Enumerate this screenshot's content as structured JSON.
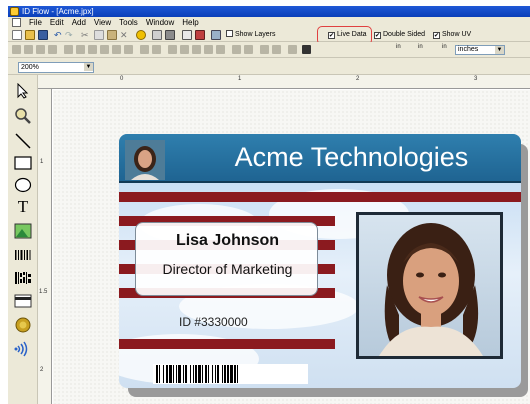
{
  "window": {
    "title": "ID Flow - [Acme.jpx]"
  },
  "menu": [
    "File",
    "Edit",
    "Add",
    "View",
    "Tools",
    "Window",
    "Help"
  ],
  "toolbar": {
    "show_layers": "Show Layers",
    "live_data": "Live Data",
    "double_sided": "Double Sided",
    "show_uv": "Show UV",
    "show_layers_checked": false,
    "live_data_checked": true,
    "double_sided_checked": true,
    "show_uv_checked": true,
    "dimension_label_w": "in",
    "dimension_label_h": "in",
    "units": "inches",
    "zoom": "200%"
  },
  "ruler": {
    "top_marks": [
      "0",
      "1",
      "2",
      "3"
    ],
    "left_marks": [
      "1",
      "1.5",
      "2"
    ]
  },
  "card": {
    "company": "Acme Technologies",
    "person_name": "Lisa Johnson",
    "person_title": "Director of Marketing",
    "id_number": "ID #3330000",
    "accent_color": "#8b1a1f",
    "header_color": "#2a76a6"
  },
  "palette_tools": [
    "pointer-tool",
    "zoom-tool",
    "line-tool",
    "rectangle-tool",
    "ellipse-tool",
    "text-tool",
    "image-tool",
    "barcode-tool",
    "2d-barcode-tool",
    "magstripe-tool",
    "smartcard-tool",
    "rfid-tool"
  ]
}
